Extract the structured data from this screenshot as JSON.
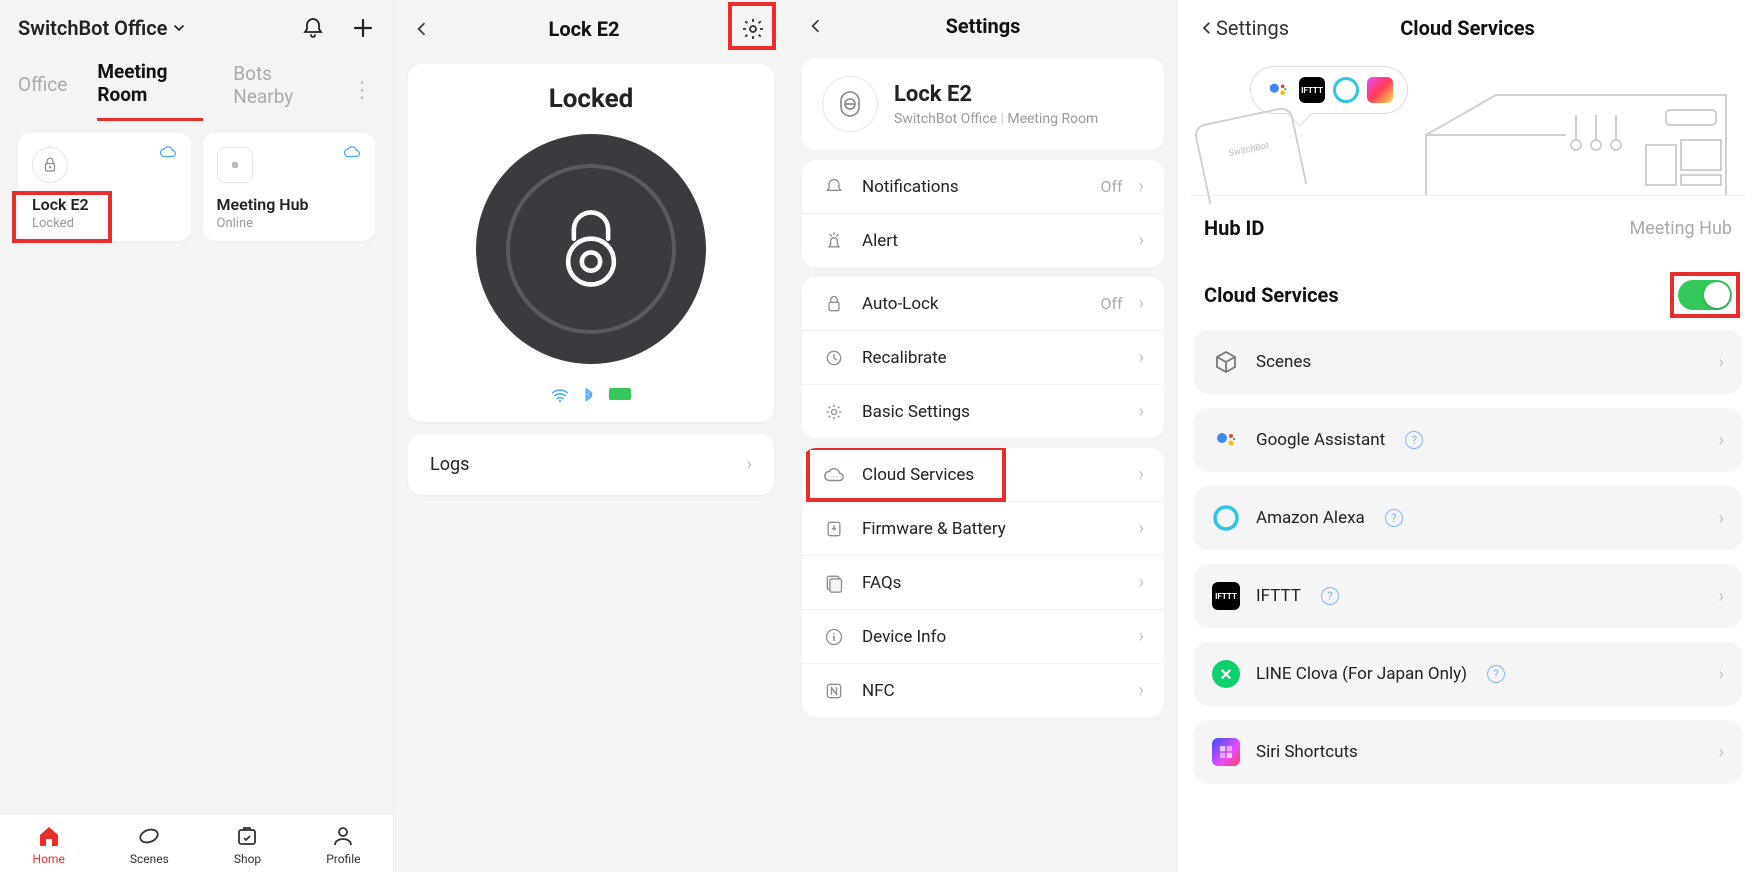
{
  "col1": {
    "location": "SwitchBot Office",
    "tabs": [
      "Office",
      "Meeting Room",
      "Bots Nearby"
    ],
    "activeTabIndex": 1,
    "cards": [
      {
        "title": "Lock E2",
        "status": "Locked"
      },
      {
        "title": "Meeting Hub",
        "status": "Online"
      }
    ],
    "nav": [
      {
        "label": "Home"
      },
      {
        "label": "Scenes"
      },
      {
        "label": "Shop"
      },
      {
        "label": "Profile"
      }
    ],
    "navActiveIndex": 0
  },
  "col2": {
    "title": "Lock E2",
    "status": "Locked",
    "logsLabel": "Logs"
  },
  "col3": {
    "title": "Settings",
    "deviceName": "Lock E2",
    "deviceLoc1": "SwitchBot Office",
    "deviceLoc2": "Meeting Room",
    "groups": [
      {
        "rows": [
          {
            "label": "Notifications",
            "value": "Off"
          },
          {
            "label": "Alert",
            "value": ""
          }
        ]
      },
      {
        "rows": [
          {
            "label": "Auto-Lock",
            "value": "Off"
          },
          {
            "label": "Recalibrate",
            "value": ""
          },
          {
            "label": "Basic Settings",
            "value": ""
          }
        ]
      },
      {
        "rows": [
          {
            "label": "Cloud Services",
            "value": "",
            "highlight": true
          },
          {
            "label": "Firmware & Battery",
            "value": ""
          },
          {
            "label": "FAQs",
            "value": ""
          },
          {
            "label": "Device Info",
            "value": ""
          },
          {
            "label": "NFC",
            "value": ""
          }
        ]
      }
    ]
  },
  "col4": {
    "backLabel": "Settings",
    "title": "Cloud Services",
    "phoneLabel": "SwitchBot",
    "hubIdLabel": "Hub ID",
    "hubIdValue": "Meeting Hub",
    "cloudServicesLabel": "Cloud Services",
    "items": [
      {
        "label": "Scenes",
        "help": false
      },
      {
        "label": "Google Assistant",
        "help": true
      },
      {
        "label": "Amazon Alexa",
        "help": true
      },
      {
        "label": "IFTTT",
        "help": true
      },
      {
        "label": "LINE Clova (For Japan Only)",
        "help": true
      },
      {
        "label": "Siri Shortcuts",
        "help": false
      }
    ],
    "iftttLabel": "IFTTT"
  }
}
